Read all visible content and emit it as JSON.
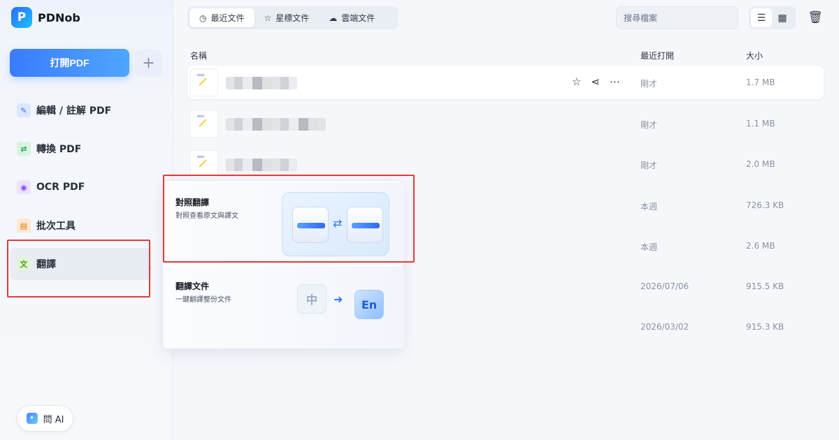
{
  "app": {
    "name": "PDNob",
    "logo_letter": "P"
  },
  "sidebar": {
    "open_button": "打開PDF",
    "add_button": "+",
    "items": [
      {
        "label": "編輯 / 註解 PDF",
        "icon": "edit-icon"
      },
      {
        "label": "轉換 PDF",
        "icon": "convert-icon"
      },
      {
        "label": "OCR PDF",
        "icon": "ocr-icon"
      },
      {
        "label": "批次工具",
        "icon": "batch-icon"
      },
      {
        "label": "翻譯",
        "icon": "translate-icon",
        "active": true
      }
    ],
    "ask_ai": "問 AI"
  },
  "header": {
    "tabs": [
      {
        "label": "最近文件",
        "icon": "clock-icon",
        "active": true
      },
      {
        "label": "星標文件",
        "icon": "star-icon"
      },
      {
        "label": "雲端文件",
        "icon": "cloud-icon"
      }
    ],
    "search_placeholder": "搜尋檔案"
  },
  "file_list": {
    "columns": {
      "name": "名稱",
      "opened": "最近打開",
      "size": "大小"
    },
    "rows": [
      {
        "opened": "剛才",
        "size": "1.7 MB"
      },
      {
        "opened": "剛才",
        "size": "1.1 MB"
      },
      {
        "opened": "剛才",
        "size": "2.0 MB"
      },
      {
        "opened": "本週",
        "size": "726.3 KB"
      },
      {
        "opened": "本週",
        "size": "2.6 MB"
      },
      {
        "opened": "2026/07/06",
        "size": "915.5 KB"
      },
      {
        "opened": "2026/03/02",
        "size": "915.3 KB"
      }
    ]
  },
  "translate_menu": {
    "options": [
      {
        "title": "對照翻譯",
        "desc": "對照查看原文與譯文"
      },
      {
        "title": "翻譯文件",
        "desc": "一鍵翻譯整份文件",
        "glyph_from": "中",
        "glyph_to": "En"
      }
    ]
  },
  "colors": {
    "accent": "#3a7bff",
    "highlight": "#e23b3b"
  }
}
